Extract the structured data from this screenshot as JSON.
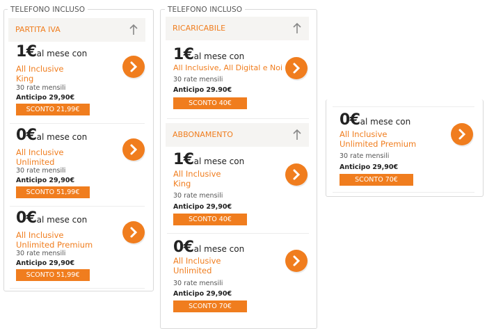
{
  "columns": [
    {
      "legend": "TELEFONO INCLUSO",
      "sections": [
        {
          "title": "PARTITA IVA",
          "offers": [
            {
              "big": "1€",
              "small": "al mese con",
              "plan_lines": [
                "All Inclusive",
                "King"
              ],
              "rate": "30 rate mensili",
              "anticipo": "Anticipo 29,90€",
              "sconto": "SCONTO 21,99€"
            },
            {
              "big": "0€",
              "small": "al mese con",
              "plan_lines": [
                "All Inclusive",
                "Unlimited"
              ],
              "rate": "30 rate mensili",
              "anticipo": "Anticipo 29,90€",
              "sconto": "SCONTO 51,99€"
            },
            {
              "big": "0€",
              "small": "al mese con",
              "plan_lines": [
                "All Inclusive",
                "Unlimited Premium"
              ],
              "rate": "30 rate mensili",
              "anticipo": "Anticipo 29,90€",
              "sconto": "SCONTO 51,99€"
            }
          ]
        }
      ]
    },
    {
      "legend": "TELEFONO INCLUSO",
      "sections": [
        {
          "title": "RICARICABILE",
          "offers": [
            {
              "big": "1€",
              "small": "al mese con",
              "plan_lines": [
                "All Inclusive, All Digital e Noi"
              ],
              "rate": "30 rate mensili",
              "anticipo": "Anticipo 29.90€",
              "sconto": "SCONTO 40€"
            }
          ]
        },
        {
          "title": "ABBONAMENTO",
          "offers": [
            {
              "big": "1€",
              "small": "al mese con",
              "plan_lines": [
                "All Inclusive",
                "King"
              ],
              "rate": "30 rate mensili",
              "anticipo": "Anticipo 29,90€",
              "sconto": "SCONTO 40€"
            },
            {
              "big": "0€",
              "small": "al mese con",
              "plan_lines": [
                "All Inclusive",
                "Unlimited"
              ],
              "rate": "30 rate mensili",
              "anticipo": "Anticipo 29,90€",
              "sconto": "SCONTO 70€"
            }
          ]
        }
      ]
    },
    {
      "offers": [
        {
          "big": "0€",
          "small": "al mese con",
          "plan_lines": [
            "All Inclusive",
            "Unlimited Premium"
          ],
          "rate": "30 rate mensili",
          "anticipo": "Anticipo 29,90€",
          "sconto": "SCONTO 70€"
        }
      ]
    }
  ],
  "colors": {
    "accent": "#f07d1e",
    "category_bg": "#f5f4f2",
    "border": "#d9d9d9"
  },
  "icons": {
    "go": "chevron-right-icon",
    "collapse": "arrow-up-icon"
  }
}
